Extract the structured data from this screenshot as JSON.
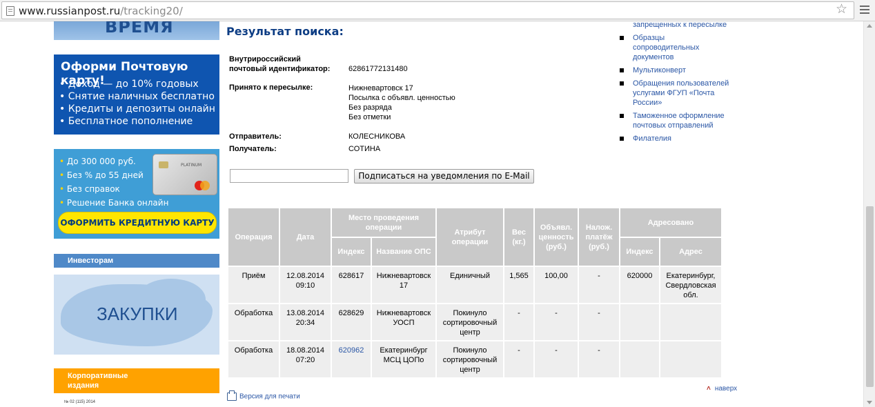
{
  "browser": {
    "url_domain": "www.russianpost.ru",
    "url_path": "/tracking20/"
  },
  "left": {
    "banner_time_text": "ВРЕМЯ",
    "card_banner": {
      "title": "Оформи Почтовую карту!",
      "items": [
        "Доход — до 10% годовых",
        "Снятие наличных бесплатно",
        "Кредиты и депозиты онлайн",
        "Бесплатное пополнение"
      ]
    },
    "credit_banner": {
      "items": [
        "До 300 000 руб.",
        "Без % до 55 дней",
        "Без справок",
        "Решение Банка онлайн"
      ],
      "card_label": "PLATINUM",
      "button": "ОФОРМИТЬ КРЕДИТНУЮ КАРТУ"
    },
    "investors": "Инвесторам",
    "procurement": "ЗАКУПКИ",
    "corporate": [
      "Корпоративные",
      "издания"
    ],
    "issue": "№ 02 (115) 2014"
  },
  "main": {
    "title": "Результат поиска:",
    "identifier_label": [
      "Внутрироссийский",
      "почтовый идентификатор:"
    ],
    "identifier_value": "62861772131480",
    "accepted_label": "Принято к пересылке:",
    "accepted_values": [
      "Нижневартовск 17",
      "Посылка с объявл. ценностью",
      "Без разряда",
      "Без отметки"
    ],
    "sender_label": "Отправитель:",
    "sender_value": "КОЛЕСНИКОВА",
    "recipient_label": "Получатель:",
    "recipient_value": "СОТИНА",
    "email_value": "",
    "subscribe_button": "Подписаться на уведомления по E-Mail",
    "table": {
      "headers": {
        "operation": "Операция",
        "date": "Дата",
        "place": "Место проведения операции",
        "index": "Индекс",
        "ops_name": "Название ОПС",
        "attribute": "Атрибут операции",
        "weight": "Вес (кг.)",
        "declared": "Объявл. ценность (руб.)",
        "cod": "Налож. платёж (руб.)",
        "addressed": "Адресовано",
        "addr_index": "Индекс",
        "address": "Адрес"
      },
      "rows": [
        {
          "operation": "Приём",
          "date": [
            "12.08.2014",
            "09:10"
          ],
          "index": "628617",
          "ops": [
            "Нижневартовск",
            "17"
          ],
          "attribute": [
            "Единичный"
          ],
          "weight": "1,565",
          "declared": "100,00",
          "cod": "-",
          "addr_index": "620000",
          "address": [
            "Екатеринбург,",
            "Свердловская",
            "обл."
          ]
        },
        {
          "operation": "Обработка",
          "date": [
            "13.08.2014",
            "20:34"
          ],
          "index": "628629",
          "ops": [
            "Нижневартовск",
            "УОСП"
          ],
          "attribute": [
            "Покинуло",
            "сортировочный",
            "центр"
          ],
          "weight": "-",
          "declared": "-",
          "cod": "-",
          "addr_index": "",
          "address": []
        },
        {
          "operation": "Обработка",
          "date": [
            "18.08.2014",
            "07:20"
          ],
          "index": "620962",
          "ops": [
            "Екатеринбург",
            "МСЦ ЦОПо"
          ],
          "attribute": [
            "Покинуло",
            "сортировочный",
            "центр"
          ],
          "weight": "-",
          "declared": "-",
          "cod": "-",
          "addr_index": "",
          "address": []
        }
      ]
    },
    "print_link": "Версия для печати",
    "top_link": "наверх"
  },
  "right_nav": [
    {
      "lines": [
        "запрещенных к пересылке"
      ]
    },
    {
      "lines": [
        "Образцы",
        "сопроводительных",
        "документов"
      ]
    },
    {
      "lines": [
        "Мультиконверт"
      ]
    },
    {
      "lines": [
        "Обращения пользователей",
        "услугами ФГУП «Почта",
        "России»"
      ]
    },
    {
      "lines": [
        "Таможенное оформление",
        "почтовых отправлений"
      ]
    },
    {
      "lines": [
        "Филателия"
      ]
    }
  ]
}
